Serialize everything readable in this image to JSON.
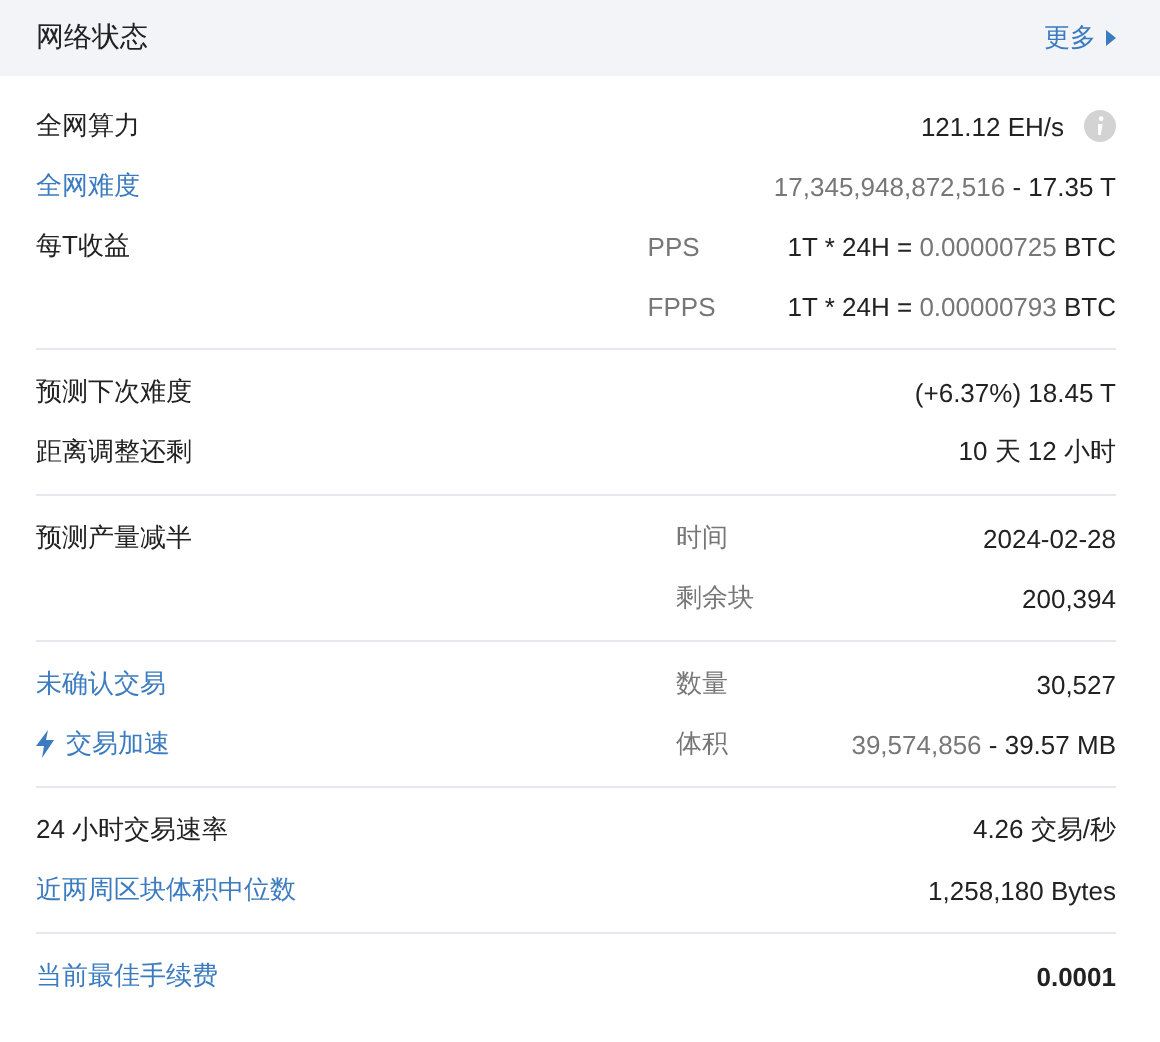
{
  "panel": {
    "title": "网络状态",
    "more_link": "更多"
  },
  "sections": [
    {
      "rows": [
        {
          "label": "全网算力",
          "link": false,
          "info": true,
          "value": [
            {
              "text": "121.12 EH/s",
              "muted": false
            }
          ]
        },
        {
          "label": "全网难度",
          "link": true,
          "value": [
            {
              "text": "17,345,948,872,516",
              "muted": true
            },
            {
              "text": " - 17.35 T",
              "muted": false
            }
          ]
        },
        {
          "label": "每T收益",
          "link": false,
          "sublabel": "PPS",
          "value": [
            {
              "text": "1T * 24H = ",
              "muted": false
            },
            {
              "text": "0.00000725",
              "muted": true
            },
            {
              "text": " BTC",
              "muted": false
            }
          ]
        },
        {
          "sublabel": "FPPS",
          "value": [
            {
              "text": "1T * 24H = ",
              "muted": false
            },
            {
              "text": "0.00000793",
              "muted": true
            },
            {
              "text": " BTC",
              "muted": false
            }
          ]
        }
      ]
    },
    {
      "rows": [
        {
          "label": "预测下次难度",
          "link": false,
          "value": [
            {
              "text": "(+6.37%) 18.45 T",
              "muted": false
            }
          ]
        },
        {
          "label": "距离调整还剩",
          "link": false,
          "value": [
            {
              "text": "10 天 12 小时",
              "muted": false
            }
          ]
        }
      ]
    },
    {
      "rows": [
        {
          "label": "预测产量减半",
          "link": false,
          "sublabel": "时间",
          "value": [
            {
              "text": "2024-02-28",
              "muted": false
            }
          ]
        },
        {
          "sublabel": "剩余块",
          "value": [
            {
              "text": "200,394",
              "muted": false
            }
          ]
        }
      ]
    },
    {
      "rows": [
        {
          "label": "未确认交易",
          "link": true,
          "sublabel": "数量",
          "value": [
            {
              "text": "30,527",
              "muted": false
            }
          ]
        },
        {
          "label": "交易加速",
          "link": true,
          "bolt": true,
          "sublabel": "体积",
          "value": [
            {
              "text": "39,574,856",
              "muted": true
            },
            {
              "text": " - 39.57 MB",
              "muted": false
            }
          ]
        }
      ]
    },
    {
      "rows": [
        {
          "label": "24 小时交易速率",
          "link": false,
          "value": [
            {
              "text": "4.26 交易/秒",
              "muted": false
            }
          ]
        },
        {
          "label": "近两周区块体积中位数",
          "link": true,
          "value": [
            {
              "text": "1,258,180 Bytes",
              "muted": false
            }
          ]
        }
      ]
    },
    {
      "rows": [
        {
          "label": "当前最佳手续费",
          "link": true,
          "bold": true,
          "value": [
            {
              "text": "0.0001",
              "muted": false
            }
          ]
        }
      ]
    }
  ]
}
